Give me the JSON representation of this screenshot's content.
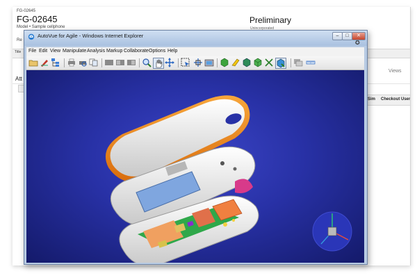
{
  "background_page": {
    "top_label": "FG-02645",
    "title": "FG-02645",
    "model_line": "Model • Sample cellphone",
    "re_label": "Re",
    "status": "Preliminary",
    "status_sub": "Unincorporated",
    "tab_label": "Title",
    "side_label": "Att",
    "views_label": "Views",
    "table_headers": [
      "Sim",
      "Checkout User"
    ]
  },
  "window": {
    "title": "AutoVue for Agile - Windows Internet Explorer",
    "menu": [
      "File",
      "Edit",
      "View",
      "Manipulate",
      "Analysis",
      "Markup",
      "Collaborate",
      "Options",
      "Help"
    ],
    "toolbar_icons": [
      "open-icon",
      "markup-pen-icon",
      "tree-icon",
      "print-icon",
      "print-preview-icon",
      "copy-icon",
      "view-a-icon",
      "view-b-icon",
      "view-c-icon",
      "zoom-icon",
      "hand-pan-icon",
      "rotate-icon",
      "select-icon",
      "fit-icon",
      "camera-icon",
      "shaded-icon",
      "solid-icon",
      "wireframe-icon",
      "cube-icon",
      "explode-icon",
      "settings-icon",
      "panel-icon",
      "measure-icon"
    ]
  },
  "colors": {
    "viewport_bg": "#2831a6",
    "orange_trim": "#f08a1a",
    "shell": "#e6e6e6",
    "screen": "#7fa6df"
  }
}
